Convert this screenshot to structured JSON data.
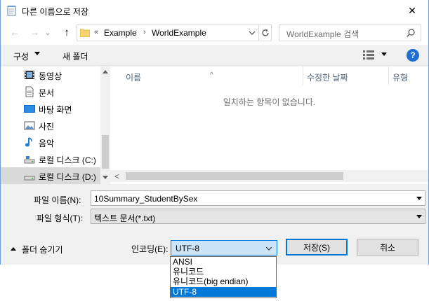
{
  "window": {
    "title": "다른 이름으로 저장",
    "close_glyph": "✕"
  },
  "nav": {
    "back_glyph": "←",
    "forward_glyph": "→",
    "recent_glyph": "⌄",
    "up_glyph": "↑",
    "breadcrumb_prefix": "«",
    "breadcrumb": [
      "Example",
      "WorldExample"
    ],
    "search_placeholder": "WorldExample 검색"
  },
  "toolbar": {
    "organize": "구성",
    "new_folder": "새 폴더",
    "help": "?"
  },
  "sidebar": {
    "items": [
      {
        "label": "동영상",
        "icon": "video-icon"
      },
      {
        "label": "문서",
        "icon": "document-icon"
      },
      {
        "label": "바탕 화면",
        "icon": "desktop-icon"
      },
      {
        "label": "사진",
        "icon": "picture-icon"
      },
      {
        "label": "음악",
        "icon": "music-icon"
      },
      {
        "label": "로컬 디스크 (C:)",
        "icon": "drive-icon"
      },
      {
        "label": "로컬 디스크 (D:)",
        "icon": "drive-icon"
      }
    ]
  },
  "filelist": {
    "columns": [
      "이름",
      "수정한 날짜",
      "유형"
    ],
    "sort_glyph": "^",
    "empty_message": "일치하는 항목이 없습니다.",
    "scroll_left_glyph": "<"
  },
  "form": {
    "filename_label": "파일 이름(N):",
    "filename_value": "10Summary_StudentBySex",
    "filetype_label": "파일 형식(T):",
    "filetype_value": "텍스트 문서(*.txt)",
    "hide_folders": "폴더 숨기기",
    "encoding_label": "인코딩(E):",
    "encoding_value": "UTF-8",
    "save_button": "저장(S)",
    "cancel_button": "취소"
  },
  "encoding_options": [
    "ANSI",
    "유니코드",
    "유니코드(big endian)",
    "UTF-8"
  ],
  "encoding_selected_index": 3,
  "colors": {
    "accent": "#0078d7",
    "help_blue": "#1f6fd1",
    "selected_bg": "#cce4f7"
  }
}
